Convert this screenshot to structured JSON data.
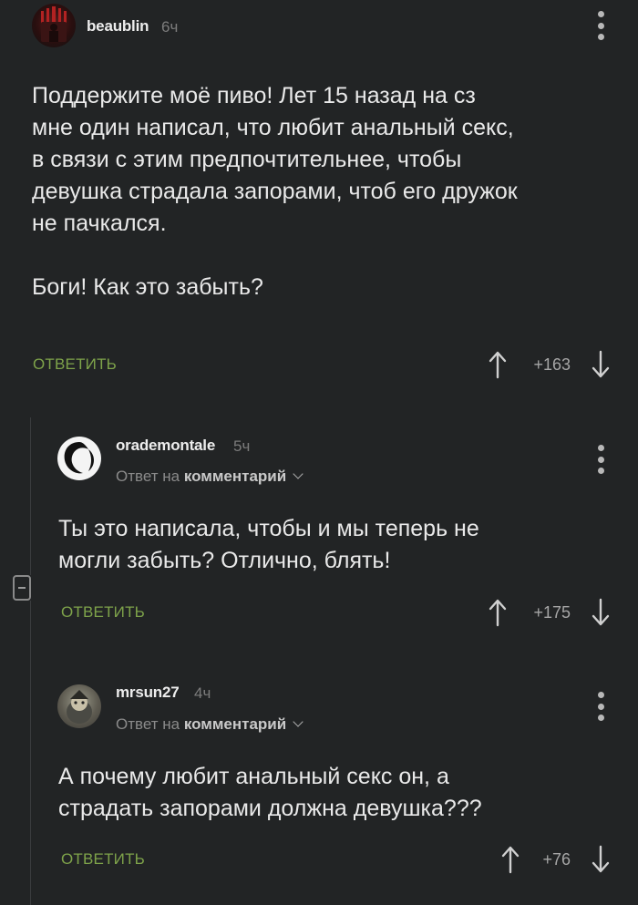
{
  "comments": [
    {
      "username": "beaublin",
      "time": "6ч",
      "text": "Поддержите моё пиво! Лет 15 назад на сз\nмне один написал, что любит анальный секс,\nв связи с этим предпочтительнее, чтобы\nдевушка страдала запорами, чтоб его дружок\nне пачкался.\n\nБоги! Как это забыть?",
      "reply_label": "ОТВЕТИТЬ",
      "score": "+163"
    },
    {
      "username": "orademontale",
      "time": "5ч",
      "reply_prefix": "Ответ на",
      "reply_target": "комментарий",
      "text": "Ты это написала, чтобы и мы теперь не\nмогли забыть? Отлично, блять!",
      "reply_label": "ОТВЕТИТЬ",
      "score": "+175"
    },
    {
      "username": "mrsun27",
      "time": "4ч",
      "reply_prefix": "Ответ на",
      "reply_target": "комментарий",
      "text": "А почему любит анальный секс он, а\nстрадать запорами должна девушка???",
      "reply_label": "ОТВЕТИТЬ",
      "score": "+76"
    }
  ],
  "colors": {
    "background": "#222425",
    "accent_green": "#7ea34a",
    "muted": "#7c7c7c"
  },
  "icons": [
    "more-vertical-icon",
    "arrow-up-icon",
    "arrow-down-icon",
    "collapse-thread-icon",
    "chevron-down-icon"
  ]
}
